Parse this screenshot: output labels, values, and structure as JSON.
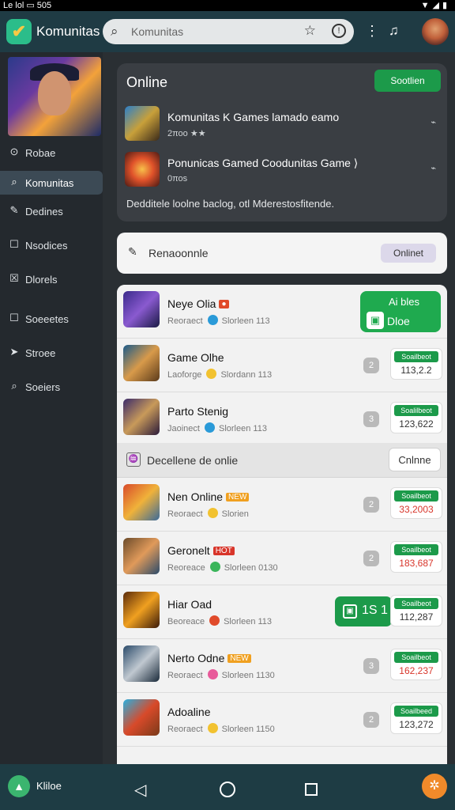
{
  "statusbar": {
    "left": "Le lol  ▭ 505",
    "right": "▼◢▮"
  },
  "app": {
    "title": "Komunitas",
    "search_placeholder": "Komunitas",
    "icons": {
      "logo": "leaf-logo",
      "search": "search-icon",
      "star": "star-icon",
      "alert": "alert-icon",
      "menu": "more-vert-icon",
      "notif": "bell-icon"
    }
  },
  "sidebar": {
    "items": [
      {
        "label": "Robae",
        "icon": "⊙"
      },
      {
        "label": "Komunitas",
        "icon": "⌕"
      },
      {
        "label": "Dedines",
        "icon": "✎"
      },
      {
        "label": "Nsodices",
        "icon": "☐"
      },
      {
        "label": "Dlorels",
        "icon": "☒"
      },
      {
        "label": "Soeeetes",
        "icon": "☐"
      },
      {
        "label": "Stroee",
        "icon": "➤"
      },
      {
        "label": "Soeiers",
        "icon": "⌕"
      }
    ]
  },
  "online": {
    "title": "Online",
    "button": "Sootlien",
    "rows": [
      {
        "title": "Komunitas K Games lamado eamo",
        "sub": "2ποο ★★",
        "more": "⌁"
      },
      {
        "title": "Ponunicas Gamed Coodunitas Game ⟩",
        "sub": "0ποs",
        "more": "⌁"
      }
    ],
    "desc": "Dedditele loolne baclog, otl Mderestosfitende."
  },
  "recommend": {
    "label": "Renaoonnle",
    "badge": "Onlinet"
  },
  "section": {
    "label": "Decellene de onlie",
    "button": "Cnlnne"
  },
  "games": [
    {
      "name": "Neye Olia",
      "sub": "Reoraect",
      "stat": "Slorleen 113",
      "big_top": "Ai bles",
      "big_bottom": "Dloe"
    },
    {
      "name": "Game Olhe",
      "sub": "Laoforge",
      "stat": "Slordann 113",
      "badge": "2",
      "pill": "Soailbeot",
      "value": "113,2.2",
      "value_red": false
    },
    {
      "name": "Parto Stenig",
      "sub": "Jaoinect",
      "stat": "Slorleen 113",
      "badge": "3",
      "pill": "Soalilbeot",
      "value": "123,622",
      "value_red": false
    },
    {
      "name": "Nen Online",
      "tag": "NEW",
      "sub": "Reoraect",
      "stat": "Slorien",
      "badge": "2",
      "pill": "Soailbeot",
      "value": "33,2003",
      "value_red": true
    },
    {
      "name": "Geronelt",
      "tag": "HOT",
      "sub": "Reoreace",
      "stat": "Slorleen 0130",
      "badge": "2",
      "pill": "Soailbeot",
      "value": "183,687",
      "value_red": true
    },
    {
      "name": "Hiar Oad",
      "sub": "Beoreace",
      "stat": "Slorleen 113",
      "badge": "1",
      "gpill": "1S 1",
      "pill": "Soailbeot",
      "value": "112,287",
      "value_red": false
    },
    {
      "name": "Nerto Odne",
      "tag": "NEW",
      "sub": "Reoraect",
      "stat": "Slorleen 1130",
      "badge": "3",
      "pill": "Soailbeot",
      "value": "162,237",
      "value_red": true
    },
    {
      "name": "Adoaline",
      "sub": "Reoraect",
      "stat": "Slorleen 1150",
      "badge": "2",
      "pill": "Soailbeed",
      "value": "123,272",
      "value_red": false
    }
  ],
  "bottom": {
    "label": "Kliloe"
  }
}
